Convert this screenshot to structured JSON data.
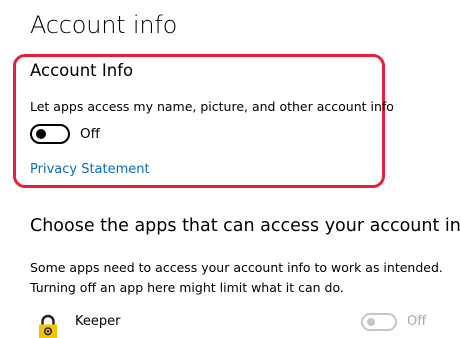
{
  "page": {
    "title": "Account info"
  },
  "account_info_section": {
    "title": "Account Info",
    "setting_label": "Let apps access my name, picture, and other account info",
    "toggle_state": "Off",
    "link_text": "Privacy Statement"
  },
  "apps_section": {
    "title": "Choose the apps that can access your account info",
    "description_lines": [
      "Some apps need to access your account info to work as intended.",
      "Turning off an app here might limit what it can do."
    ],
    "apps": [
      {
        "name": "Keeper",
        "icon": "keeper-lock-icon",
        "toggle_state": "Off",
        "enabled": false
      }
    ]
  },
  "colors": {
    "highlight_border": "#e5203a",
    "link": "#0a6cc2",
    "disabled_text": "#a9a9a9",
    "keeper_gold": "#f5c400"
  }
}
